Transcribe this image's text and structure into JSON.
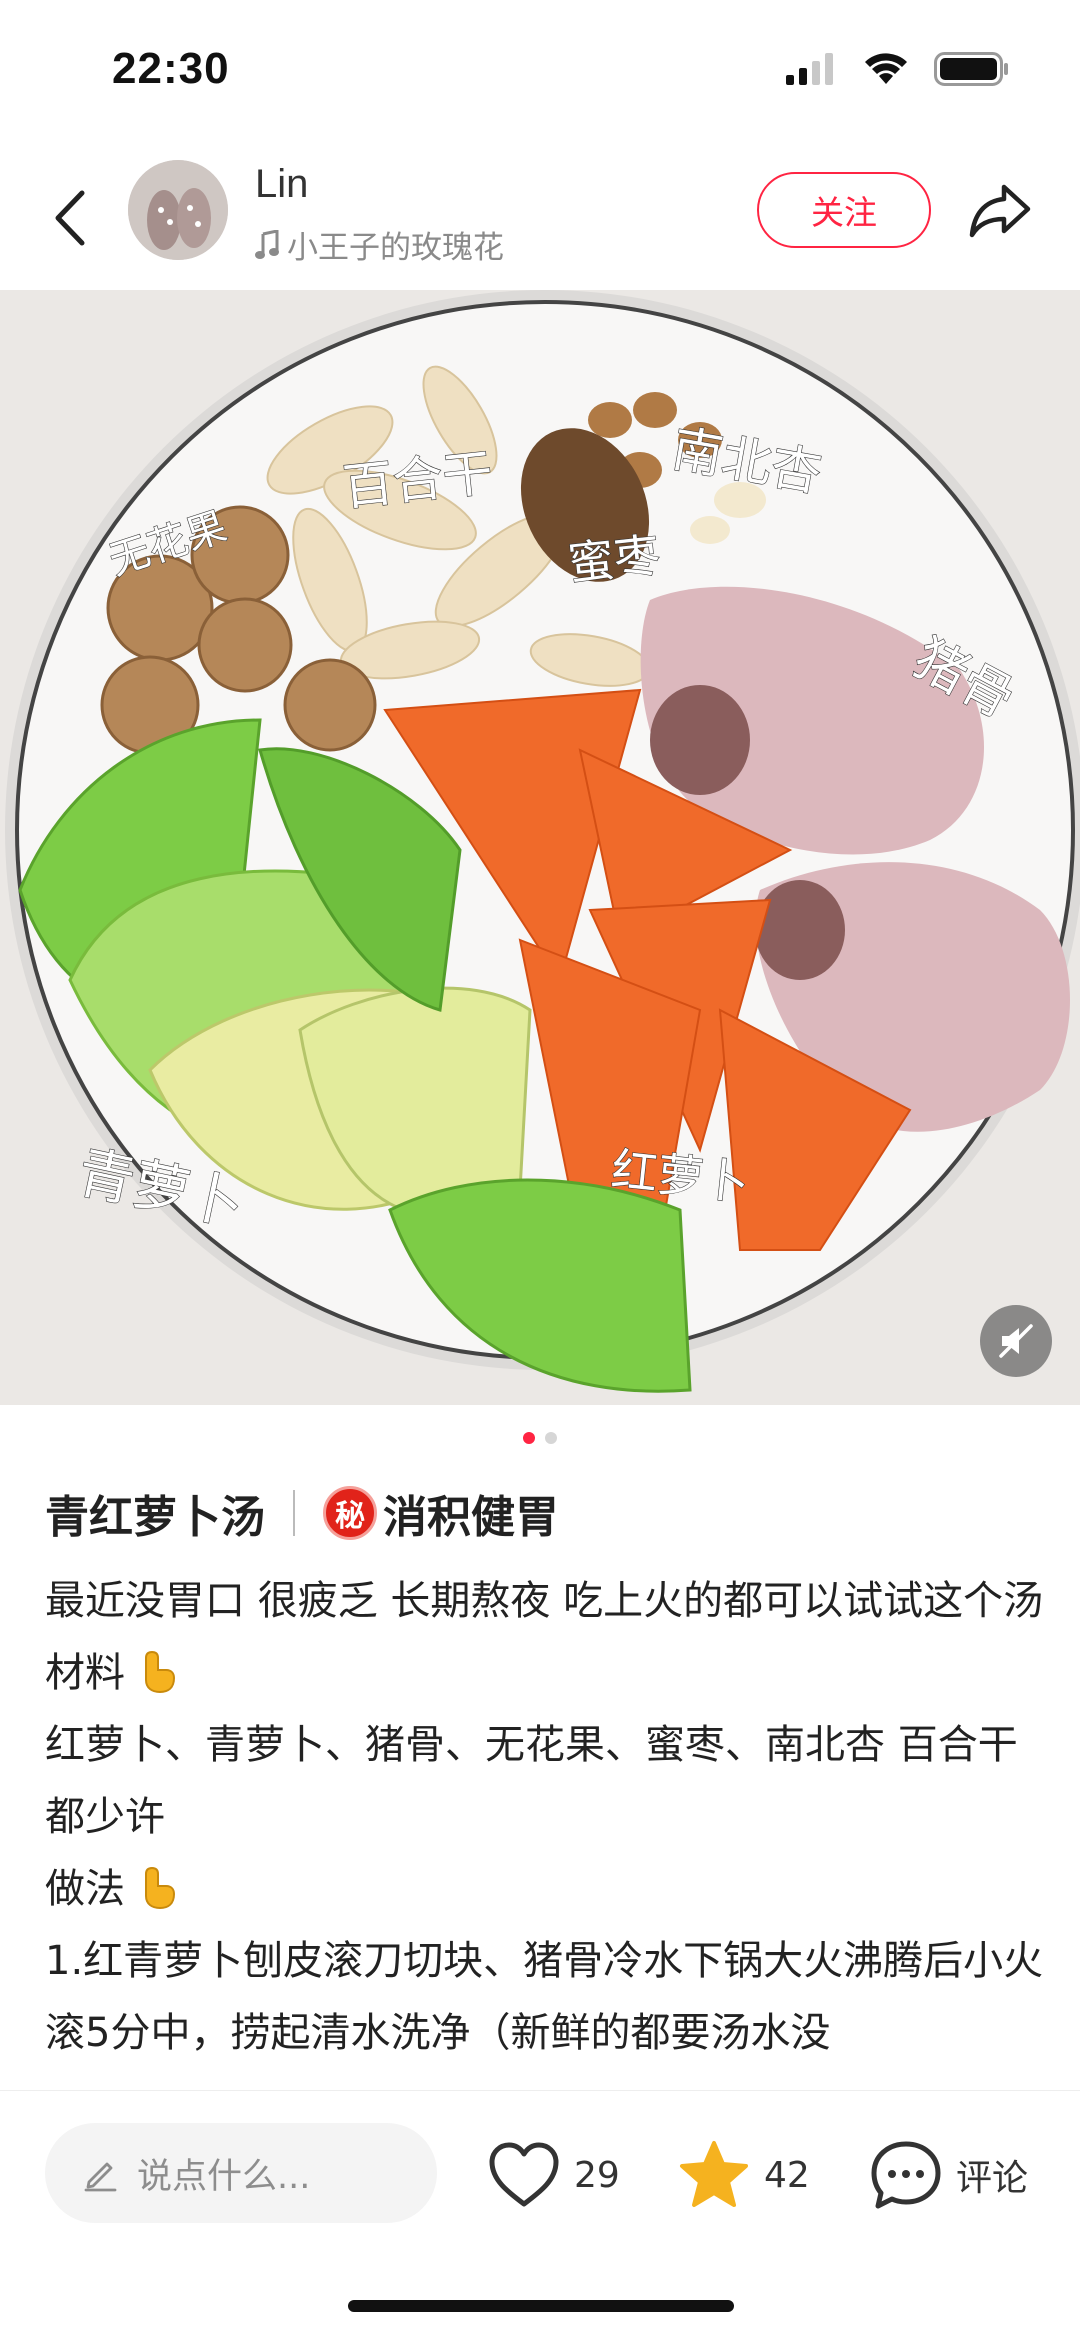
{
  "status": {
    "time": "22:30"
  },
  "header": {
    "author": "Lin",
    "music": "小王子的玫瑰花",
    "follow_label": "关注"
  },
  "photo": {
    "labels": {
      "fig": "无花果",
      "lily": "百合干",
      "date": "蜜枣",
      "almond": "南北杏",
      "pork": "猪骨",
      "green_radish": "青萝卜",
      "carrot": "红萝卜"
    }
  },
  "carousel": {
    "count": 2,
    "active": 1
  },
  "post": {
    "title": "青红萝卜汤",
    "secret_icon": "秘",
    "tag": "消积健胃",
    "lines": {
      "l1": "最近没胃口 很疲乏 长期熬夜 吃上火的都可以试试这个汤",
      "l2": "材料",
      "l3": "红萝卜、青萝卜、猪骨、无花果、蜜枣、南北杏 百合干都少许",
      "l4": "做法",
      "l5": "1.红青萝卜刨皮滚刀切块、猪骨冷水下锅大火沸腾后小火滚5分中，捞起清水洗净（新鲜的都要汤水没"
    }
  },
  "bottom": {
    "comment_placeholder": "说点什么...",
    "likes": "29",
    "favorites": "42",
    "comment_label": "评论"
  },
  "colors": {
    "accent": "#ff2442",
    "star": "#f5b21f"
  }
}
